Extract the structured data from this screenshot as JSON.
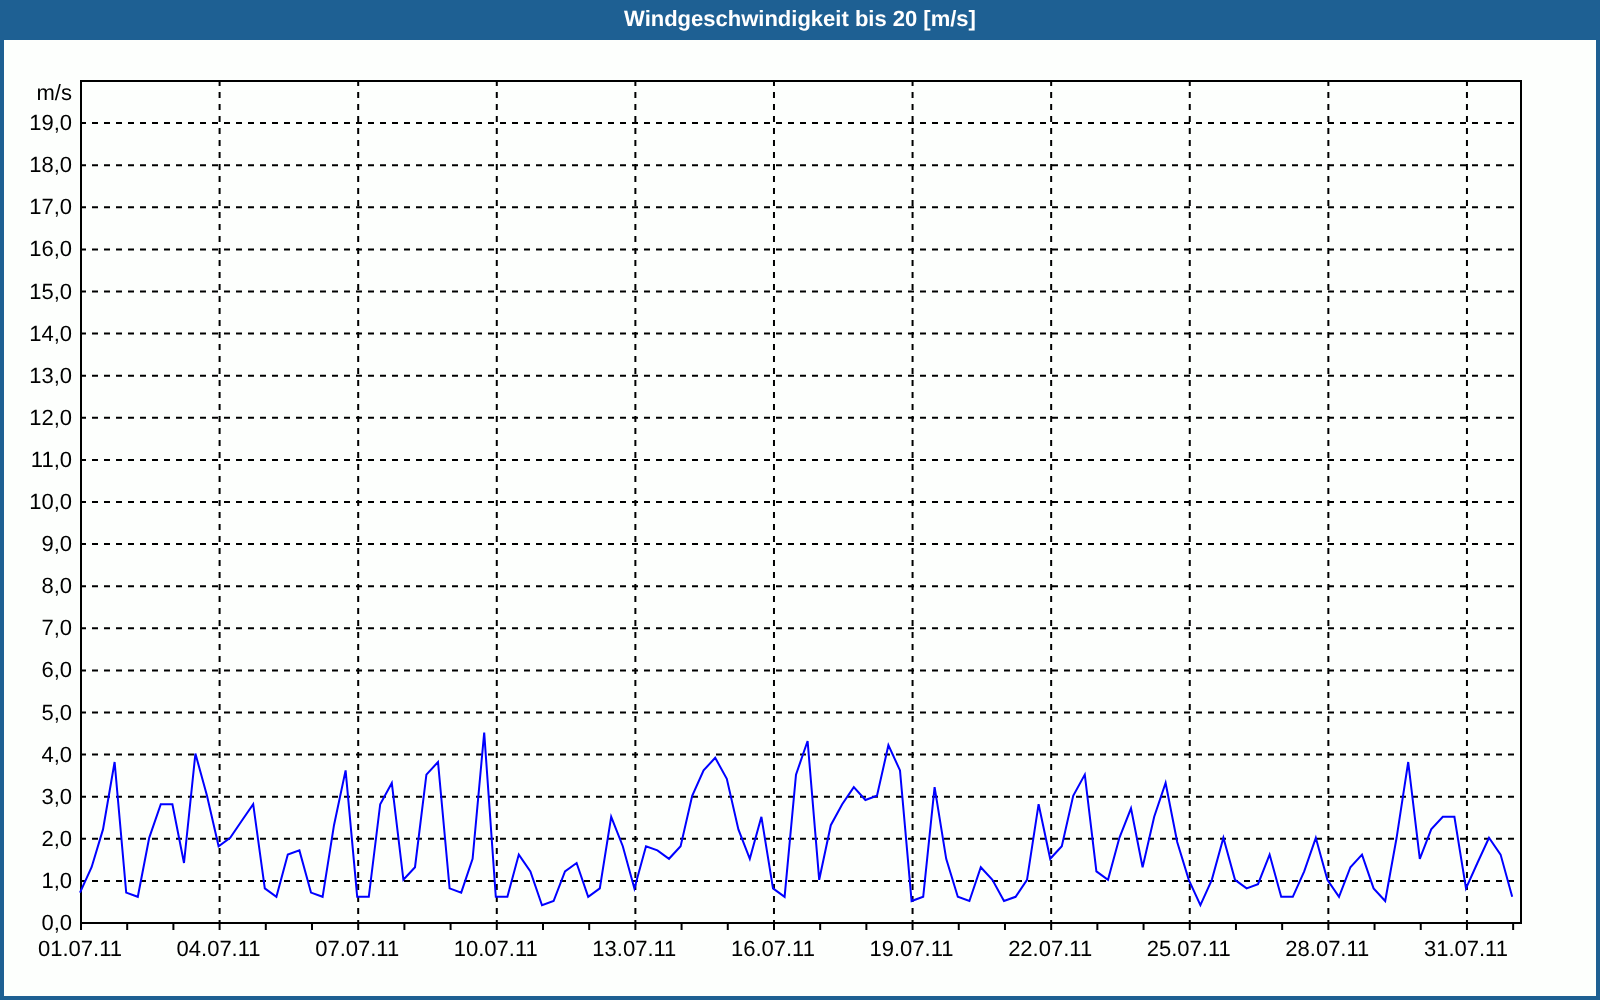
{
  "chart": {
    "chart_data": {
      "type": "line",
      "title": "Windgeschwindigkeit bis 20 [m/s]",
      "ylabel": "m/s",
      "grid": true,
      "ylim": [
        0,
        20
      ],
      "yticks": [
        {
          "value": 0,
          "label": "0,0"
        },
        {
          "value": 1,
          "label": "1,0"
        },
        {
          "value": 2,
          "label": "2,0"
        },
        {
          "value": 3,
          "label": "3,0"
        },
        {
          "value": 4,
          "label": "4,0"
        },
        {
          "value": 5,
          "label": "5,0"
        },
        {
          "value": 6,
          "label": "6,0"
        },
        {
          "value": 7,
          "label": "7,0"
        },
        {
          "value": 8,
          "label": "8,0"
        },
        {
          "value": 9,
          "label": "9,0"
        },
        {
          "value": 10,
          "label": "10,0"
        },
        {
          "value": 11,
          "label": "11,0"
        },
        {
          "value": 12,
          "label": "12,0"
        },
        {
          "value": 13,
          "label": "13,0"
        },
        {
          "value": 14,
          "label": "14,0"
        },
        {
          "value": 15,
          "label": "15,0"
        },
        {
          "value": 16,
          "label": "16,0"
        },
        {
          "value": 17,
          "label": "17,0"
        },
        {
          "value": 18,
          "label": "18,0"
        },
        {
          "value": 19,
          "label": "19,0"
        }
      ],
      "categories": [
        "01.07.11",
        null,
        null,
        null,
        null,
        null,
        null,
        null,
        null,
        null,
        null,
        null,
        "04.07.11",
        null,
        null,
        null,
        null,
        null,
        null,
        null,
        null,
        null,
        null,
        null,
        "07.07.11",
        null,
        null,
        null,
        null,
        null,
        null,
        null,
        null,
        null,
        null,
        null,
        "10.07.11",
        null,
        null,
        null,
        null,
        null,
        null,
        null,
        null,
        null,
        null,
        null,
        "13.07.11",
        null,
        null,
        null,
        null,
        null,
        null,
        null,
        null,
        null,
        null,
        null,
        "16.07.11",
        null,
        null,
        null,
        null,
        null,
        null,
        null,
        null,
        null,
        null,
        null,
        "19.07.11",
        null,
        null,
        null,
        null,
        null,
        null,
        null,
        null,
        null,
        null,
        null,
        "22.07.11",
        null,
        null,
        null,
        null,
        null,
        null,
        null,
        null,
        null,
        null,
        null,
        "25.07.11",
        null,
        null,
        null,
        null,
        null,
        null,
        null,
        null,
        null,
        null,
        null,
        "28.07.11",
        null,
        null,
        null,
        null,
        null,
        null,
        null,
        null,
        null,
        null,
        null,
        "31.07.11",
        null,
        null,
        null,
        null
      ],
      "series": [
        {
          "color": "#0000ff",
          "values": [
            0.7,
            1.3,
            2.2,
            3.8,
            0.7,
            0.6,
            2.0,
            2.8,
            2.8,
            1.4,
            4.0,
            3.0,
            1.8,
            2.0,
            2.4,
            2.8,
            0.8,
            0.6,
            1.6,
            1.7,
            0.7,
            0.6,
            2.3,
            3.6,
            0.6,
            0.6,
            2.8,
            3.3,
            1.0,
            1.3,
            3.5,
            3.8,
            0.8,
            0.7,
            1.5,
            4.5,
            0.6,
            0.6,
            1.6,
            1.2,
            0.4,
            0.5,
            1.2,
            1.4,
            0.6,
            0.8,
            2.5,
            1.8,
            0.8,
            1.8,
            1.7,
            1.5,
            1.8,
            3.0,
            3.6,
            3.9,
            3.4,
            2.2,
            1.5,
            2.5,
            0.8,
            0.6,
            3.5,
            4.3,
            1.0,
            2.3,
            2.8,
            3.2,
            2.9,
            3.0,
            4.2,
            3.6,
            0.5,
            0.6,
            3.2,
            1.5,
            0.6,
            0.5,
            1.3,
            1.0,
            0.5,
            0.6,
            1.0,
            2.8,
            1.5,
            1.8,
            3.0,
            3.5,
            1.2,
            1.0,
            2.0,
            2.7,
            1.3,
            2.5,
            3.3,
            1.9,
            1.0,
            0.4,
            1.0,
            2.0,
            1.0,
            0.8,
            0.9,
            1.6,
            0.6,
            0.6,
            1.2,
            2.0,
            1.0,
            0.6,
            1.3,
            1.6,
            0.8,
            0.5,
            2.0,
            3.8,
            1.5,
            2.2,
            2.5,
            2.5,
            0.8,
            1.4,
            2.0,
            1.6,
            0.6
          ]
        }
      ]
    }
  }
}
